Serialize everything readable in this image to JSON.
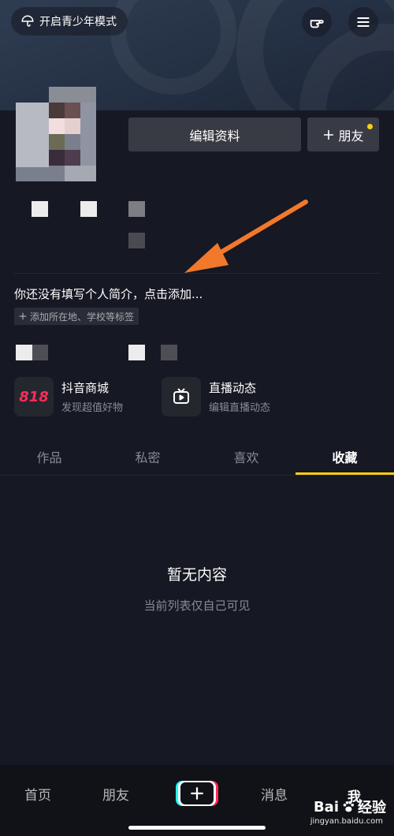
{
  "header": {
    "teen_mode_label": "开启青少年模式"
  },
  "profile": {
    "edit_label": "编辑资料",
    "friend_label": "朋友",
    "bio_placeholder": "你还没有填写个人简介，点击添加...",
    "tag_label": "添加所在地、学校等标签"
  },
  "services": [
    {
      "title": "抖音商城",
      "subtitle": "发现超值好物",
      "icon": "818"
    },
    {
      "title": "直播动态",
      "subtitle": "编辑直播动态"
    }
  ],
  "tabs": [
    {
      "label": "作品"
    },
    {
      "label": "私密"
    },
    {
      "label": "喜欢"
    },
    {
      "label": "收藏",
      "active": true
    }
  ],
  "empty": {
    "title": "暂无内容",
    "subtitle": "当前列表仅自己可见"
  },
  "nav": [
    {
      "label": "首页"
    },
    {
      "label": "朋友"
    },
    {
      "label": "消息"
    },
    {
      "label": "我",
      "active": true
    }
  ],
  "watermark": {
    "brand": "Bai",
    "brand_cn": "经验",
    "url": "jingyan.baidu.com"
  },
  "colors": {
    "background": "#161823",
    "accent": "#face15",
    "arrow": "#f2782b"
  }
}
